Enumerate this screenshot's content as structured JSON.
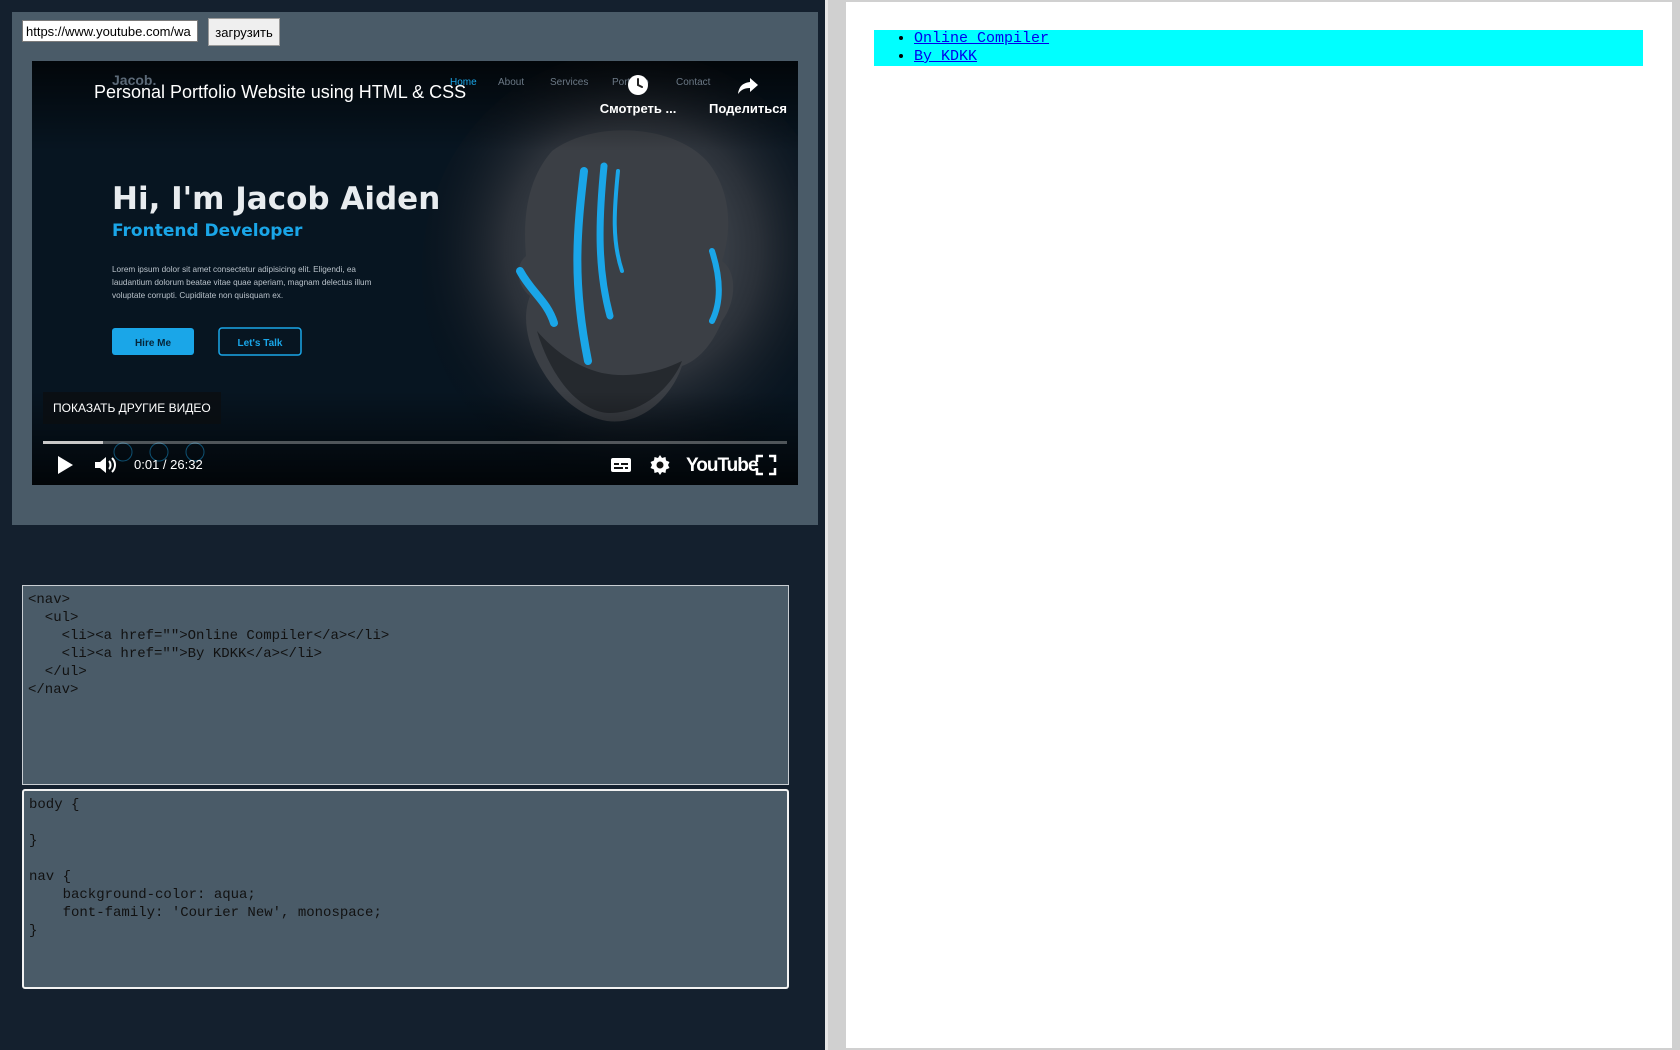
{
  "loader": {
    "url_value": "https://www.youtube.com/wa",
    "load_label": "загрузить"
  },
  "player": {
    "video_title": "Personal Portfolio Website using HTML & CSS",
    "watch_later_label": "Смотреть ...",
    "share_label": "Поделиться",
    "more_videos_label": "ПОКАЗАТЬ ДРУГИЕ ВИДЕО",
    "time_display": "0:01 / 26:32",
    "progress_fraction": 0.08,
    "logo_text": "YouTube",
    "icons": [
      "clock-icon",
      "share-icon",
      "play-icon",
      "volume-icon",
      "subtitles-icon",
      "settings-icon",
      "fullscreen-icon"
    ],
    "thumbnail": {
      "nav_items": [
        "Home",
        "About",
        "Services",
        "Portfolio",
        "Contact"
      ],
      "brand": "Jacob.",
      "heading": "Hi, I'm Jacob Aiden",
      "subheading": "Frontend Developer",
      "paragraph_lines": [
        "Lorem ipsum dolor sit amet consectetur adipisicing elit. Eligendi, ea",
        "laudantium dolorum beatae vitae quae aperiam, magnam delectus illum",
        "voluptate corrupti. Cupiditate non quisquam ex."
      ],
      "primary_button": "Hire Me",
      "secondary_button": "Let's Talk",
      "accent_color": "#1aa6e8"
    }
  },
  "editors": {
    "html_code": "<nav>\n  <ul>\n    <li><a href=\"\">Online Compiler</a></li>\n    <li><a href=\"\">By KDKK</a></li>\n  </ul>\n</nav>",
    "css_code": "body {\n\n}\n\nnav {\n    background-color: aqua;\n    font-family: 'Courier New', monospace;\n}"
  },
  "preview": {
    "nav_background": "#00ffff",
    "links": [
      "Online Compiler",
      "By KDKK"
    ]
  }
}
